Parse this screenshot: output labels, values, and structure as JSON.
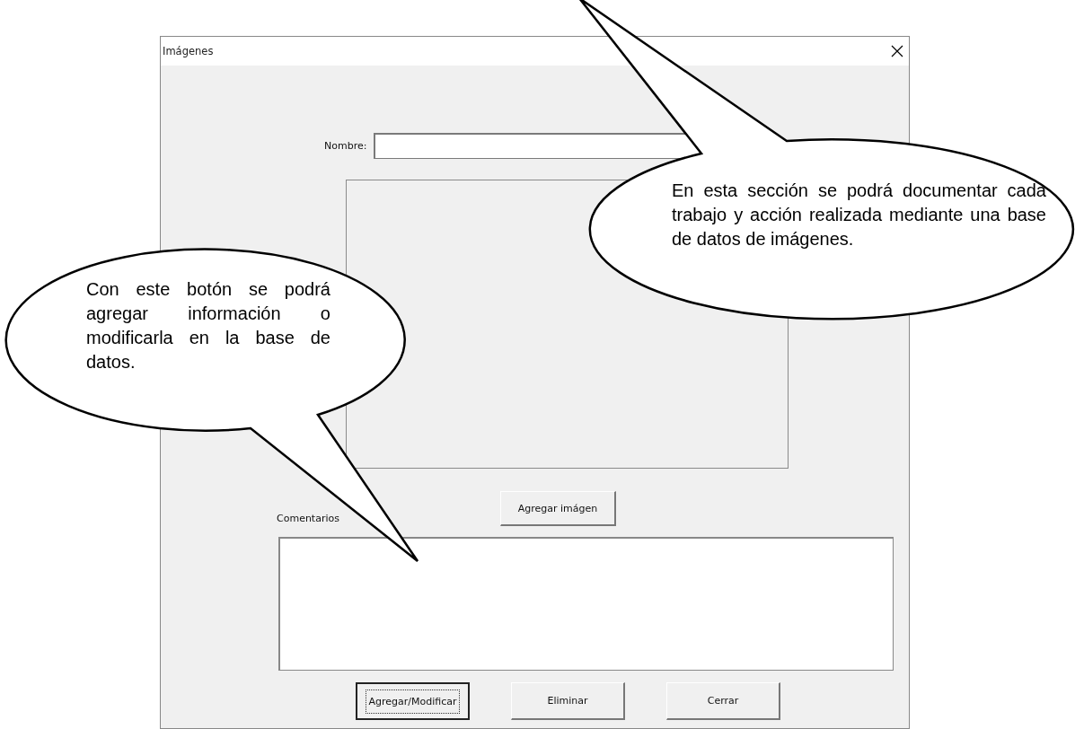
{
  "window": {
    "title": "Imágenes"
  },
  "name_field": {
    "label": "Nombre:"
  },
  "image_button": {
    "label": "Agregar imágen"
  },
  "comments": {
    "label": "Comentarios"
  },
  "buttons": [
    {
      "label": "Agregar/Modificar",
      "focused": true
    },
    {
      "label": "Eliminar",
      "focused": false
    },
    {
      "label": "Cerrar",
      "focused": false
    }
  ],
  "callouts": [
    {
      "text": "En esta sección se podrá documentar cada trabajo y acción realizada mediante una base de datos de imágenes."
    },
    {
      "text": "Con este botón se podrá agregar información o modificarla en la base de datos."
    }
  ]
}
